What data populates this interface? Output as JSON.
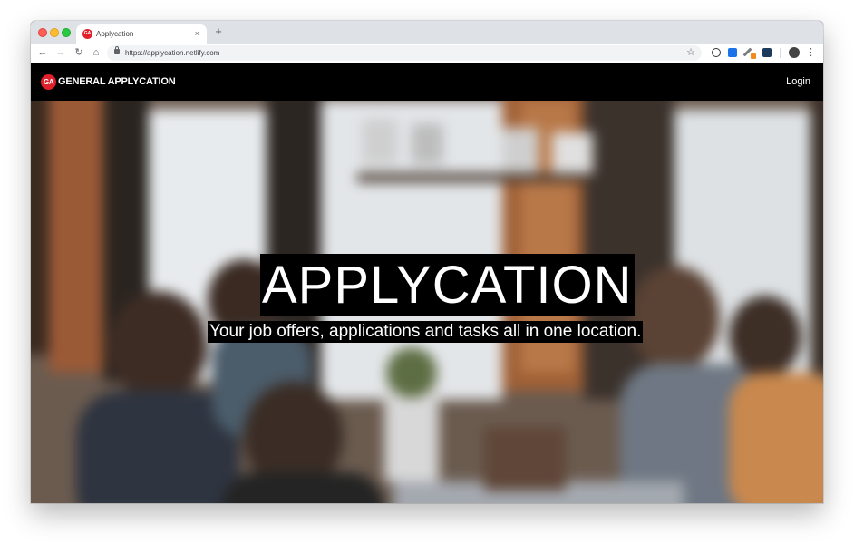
{
  "browser": {
    "tab_title": "Applycation",
    "tab_favicon_text": "GA",
    "tab_close": "×",
    "new_tab": "+",
    "url": "https://applycation.netlify.com",
    "nav": {
      "back": "←",
      "forward": "→",
      "reload": "↻",
      "home": "⌂",
      "star": "☆",
      "menu": "⋮"
    },
    "extension_icons": [
      "info-extension-icon",
      "blue-extension-icon",
      "eyedropper-extension-icon",
      "dark-extension-icon"
    ],
    "colors": {
      "tab_strip": "#dee1e6",
      "close_red": "#fe5f57",
      "minimize_yellow": "#febc2e",
      "zoom_green": "#28c840"
    }
  },
  "site": {
    "logo_badge": "GA",
    "logo_text": "GENERAL APPLYCATION",
    "login_label": "Login",
    "hero_title": "APPLYCATION",
    "hero_subtitle": "Your job offers, applications and tasks all in one location.",
    "colors": {
      "brand_red": "#e0202b",
      "navbar": "#000000",
      "text": "#ffffff"
    }
  }
}
